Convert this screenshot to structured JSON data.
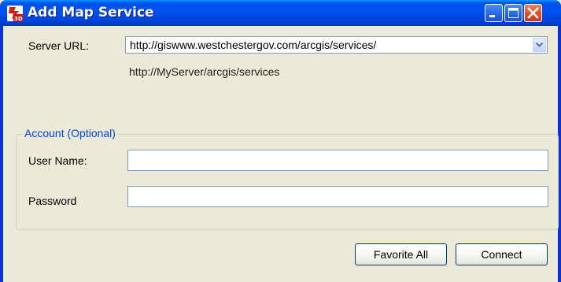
{
  "window": {
    "title": "Add Map Service",
    "icon": "app-3d-icon",
    "controls": [
      "minimize-icon",
      "maximize-icon",
      "close-icon"
    ]
  },
  "server": {
    "label": "Server URL:",
    "value": "http://giswww.westchestergov.com/arcgis/services/",
    "hint": "http://MyServer/arcgis/services"
  },
  "account": {
    "legend": "Account (Optional)",
    "username_label": "User Name:",
    "username_value": "",
    "password_label": "Password",
    "password_value": ""
  },
  "buttons": {
    "favorite_all": "Favorite All",
    "connect": "Connect"
  },
  "colors": {
    "titlebar": "#0053ee",
    "client_bg": "#ece9d8",
    "legend_text": "#0046d5",
    "close_button": "#d9532a"
  }
}
